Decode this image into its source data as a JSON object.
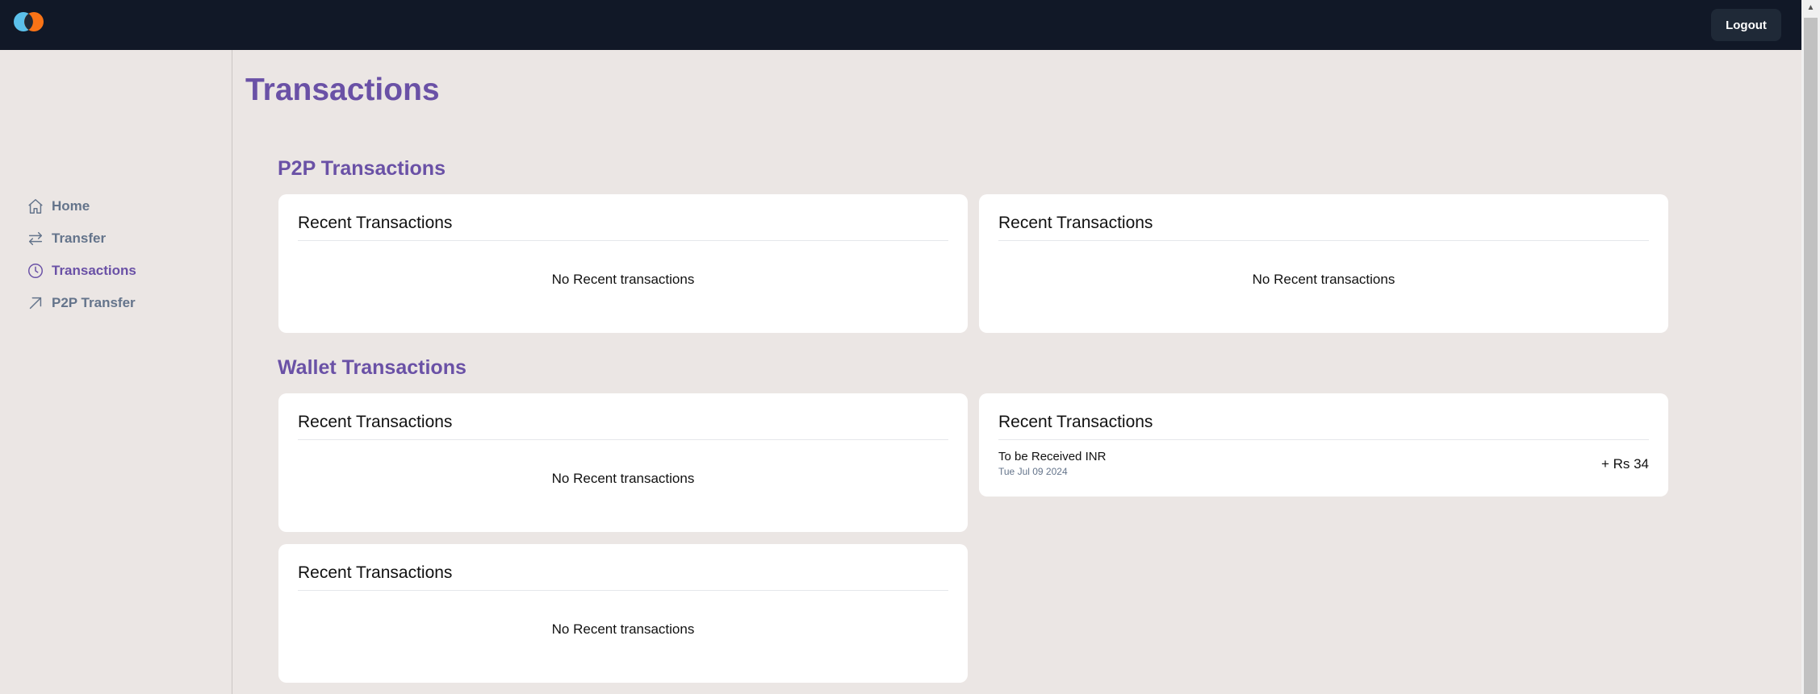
{
  "header": {
    "logout_label": "Logout",
    "logo": {
      "icon": "logo-icon",
      "colors": [
        "#5bc0eb",
        "#f97316"
      ]
    }
  },
  "sidebar": {
    "items": [
      {
        "label": "Home",
        "icon": "home-icon",
        "active": false
      },
      {
        "label": "Transfer",
        "icon": "transfer-icon",
        "active": false
      },
      {
        "label": "Transactions",
        "icon": "clock-icon",
        "active": true
      },
      {
        "label": "P2P Transfer",
        "icon": "arrow-up-right-icon",
        "active": false
      }
    ]
  },
  "main": {
    "title": "Transactions",
    "p2p": {
      "title": "P2P Transactions",
      "cards": [
        {
          "title": "Recent Transactions",
          "empty": "No Recent transactions"
        },
        {
          "title": "Recent Transactions",
          "empty": "No Recent transactions"
        }
      ]
    },
    "wallet": {
      "title": "Wallet Transactions",
      "cards": [
        {
          "title": "Recent Transactions",
          "empty": "No Recent transactions"
        },
        {
          "title": "Recent Transactions",
          "transactions": [
            {
              "label": "To be Received INR",
              "date": "Tue Jul 09 2024",
              "amount": "+ Rs 34"
            }
          ]
        },
        {
          "title": "Recent Transactions",
          "empty": "No Recent transactions"
        }
      ]
    }
  },
  "colors": {
    "accent": "#6a51a6",
    "topbar": "#111827",
    "background": "#ebe6e4",
    "nav_inactive": "#64748b"
  }
}
